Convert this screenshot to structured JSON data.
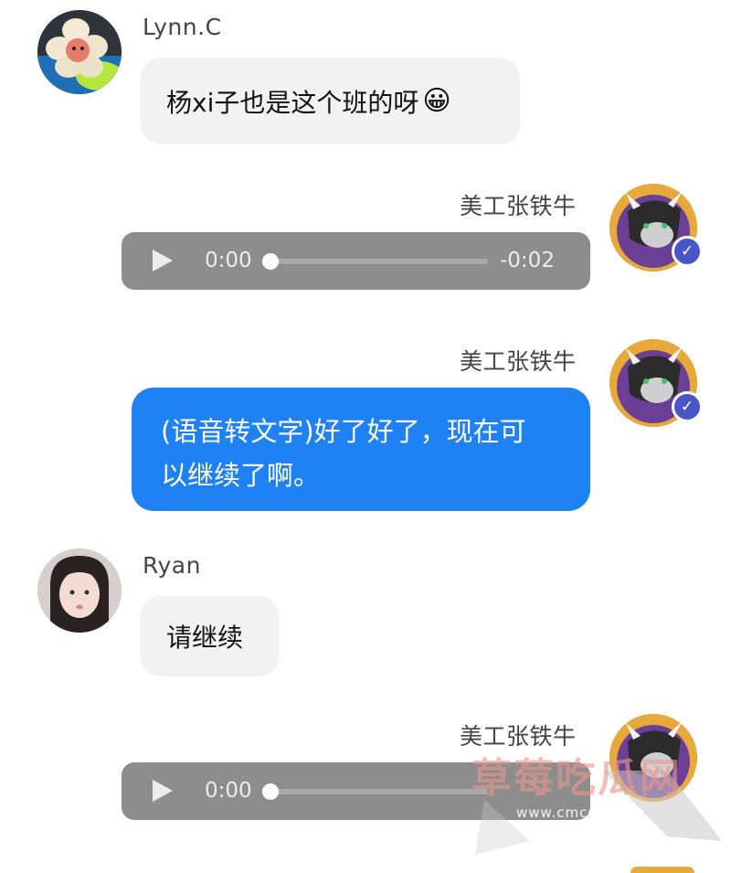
{
  "messages": [
    {
      "sender": "Lynn.C",
      "text": "杨xi子也是这个班的呀",
      "emoji": "😀"
    },
    {
      "sender": "美工张铁牛",
      "audio": {
        "elapsed": "0:00",
        "remaining": "-0:02"
      }
    },
    {
      "sender": "美工张铁牛",
      "text_line1": "(语音转文字)好了好了，现在可",
      "text_line2": "以继续了啊。"
    },
    {
      "sender": "Ryan",
      "text": "请继续"
    },
    {
      "sender": "美工张铁牛",
      "audio": {
        "elapsed": "0:00"
      }
    }
  ],
  "verified_badge": "✓",
  "watermark": {
    "title": "草莓吃瓜网",
    "url": "www.cmcgw.com"
  },
  "colors": {
    "outgoing_bubble": "#1e82f5",
    "incoming_bubble": "#f2f2f2",
    "audio_bar": "#8d8d8d",
    "verified_badge": "#4a55c8"
  }
}
